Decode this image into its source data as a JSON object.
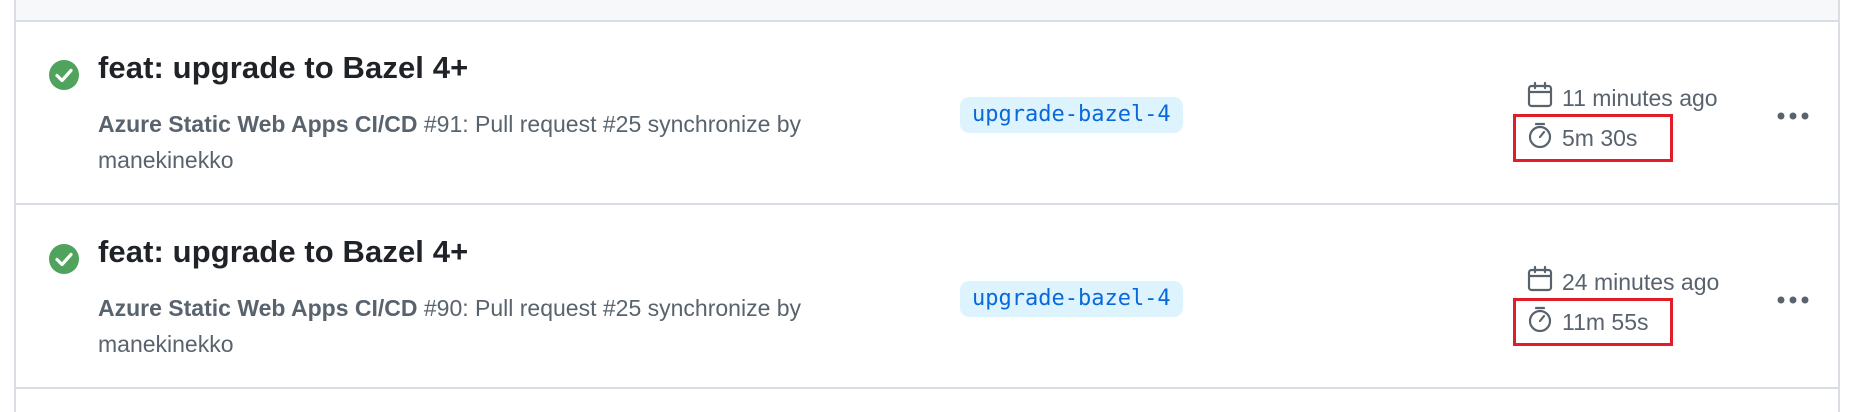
{
  "runs": [
    {
      "title": "feat: upgrade to Bazel 4+",
      "workflow": "Azure Static Web Apps CI/CD",
      "run_number": "#91",
      "description": ": Pull request #25 synchronize by manekinekko",
      "branch": "upgrade-bazel-4",
      "created": "11 minutes ago",
      "duration": "5m 30s",
      "status": "success"
    },
    {
      "title": "feat: upgrade to Bazel 4+",
      "workflow": "Azure Static Web Apps CI/CD",
      "run_number": "#90",
      "description": ": Pull request #25 synchronize by manekinekko",
      "branch": "upgrade-bazel-4",
      "created": "24 minutes ago",
      "duration": "11m 55s",
      "status": "success"
    }
  ],
  "icons": {
    "status": "check-circle-icon",
    "created": "calendar-icon",
    "duration": "stopwatch-icon",
    "menu": "kebab-menu-icon"
  },
  "colors": {
    "success": "#4fa35c",
    "branch_bg": "#ddf4ff",
    "branch_text": "#0969da",
    "highlight_box": "#e11d2a",
    "border": "#d8dee4"
  }
}
